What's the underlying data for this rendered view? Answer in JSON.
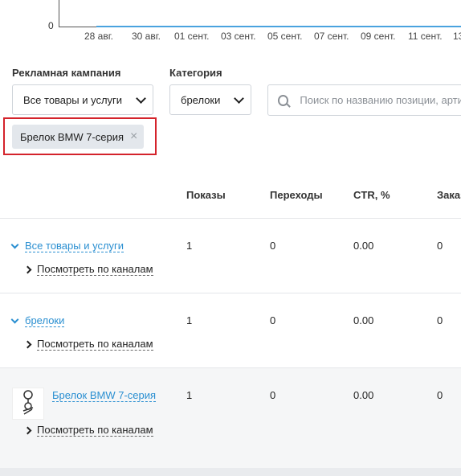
{
  "chart": {
    "y_zero_label": "0",
    "x_ticks": [
      "28 авг.",
      "30 авг.",
      "01 сент.",
      "03 сент.",
      "05 сент.",
      "07 сент.",
      "09 сент.",
      "11 сент.",
      "13"
    ]
  },
  "filters": {
    "campaign_label": "Рекламная кампания",
    "campaign_value": "Все товары и услуги",
    "category_label": "Категория",
    "category_value": "брелоки",
    "search_placeholder": "Поиск по названию позиции, артикулу"
  },
  "active_tag": {
    "label": "Брелок BMW 7-серия",
    "close": "×"
  },
  "table": {
    "headers": [
      "Показы",
      "Переходы",
      "CTR, %",
      "Заказы"
    ],
    "channels_link": "Посмотреть по каналам",
    "rows": [
      {
        "name": "Все товары и услуги",
        "values": [
          "1",
          "0",
          "0.00",
          "0"
        ]
      },
      {
        "name": "брелоки",
        "values": [
          "1",
          "0",
          "0.00",
          "0"
        ]
      },
      {
        "name": "Брелок BMW 7-серия",
        "values": [
          "1",
          "0",
          "0.00",
          "0"
        ]
      }
    ]
  },
  "colors": {
    "accent": "#2a8fd1",
    "highlight": "#d4232b",
    "chart_line": "#4aa3df"
  }
}
